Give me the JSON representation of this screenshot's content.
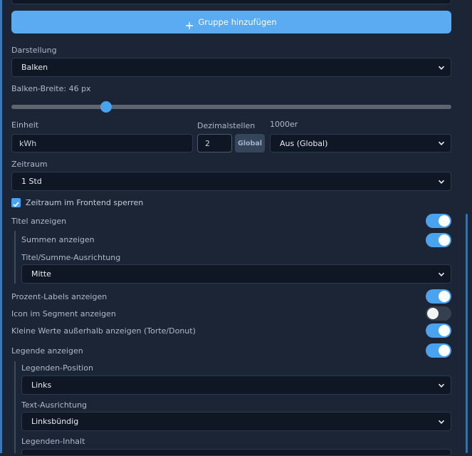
{
  "add_group_button": {
    "icon": "plus-icon",
    "label": "Gruppe hinzufügen"
  },
  "darstellung": {
    "label": "Darstellung",
    "value": "Balken"
  },
  "balken_breite": {
    "label": "Balken-Breite: 46 px",
    "slider_fraction": 0.216
  },
  "einheit": {
    "label": "Einheit",
    "value": "kWh"
  },
  "dezimalstellen": {
    "label": "Dezimalstellen",
    "value": "2",
    "global_button": "Global"
  },
  "tausender": {
    "label": "1000er",
    "value": "Aus (Global)"
  },
  "zeitraum": {
    "label": "Zeitraum",
    "value": "1 Std"
  },
  "zeitraum_sperren": {
    "label": "Zeitraum im Frontend sperren",
    "checked": true
  },
  "titel_anzeigen": {
    "label": "Titel anzeigen",
    "on": true
  },
  "summen_anzeigen": {
    "label": "Summen anzeigen",
    "on": true
  },
  "ausrichtung": {
    "label": "Titel/Summe-Ausrichtung",
    "value": "Mitte"
  },
  "prozent_labels": {
    "label": "Prozent-Labels anzeigen",
    "on": true
  },
  "icon_segment": {
    "label": "Icon im Segment anzeigen",
    "on": false
  },
  "kleine_werte": {
    "label": "Kleine Werte außerhalb anzeigen (Torte/Donut)",
    "on": true
  },
  "legende_anzeigen": {
    "label": "Legende anzeigen",
    "on": true
  },
  "legenden_position": {
    "label": "Legenden-Position",
    "value": "Links"
  },
  "text_ausrichtung": {
    "label": "Text-Ausrichtung",
    "value": "Linksbündig"
  },
  "legenden_inhalt": {
    "label": "Legenden-Inhalt"
  },
  "colors": {
    "accent": "#4aa3ee",
    "button": "#5aabf2",
    "background": "#1b2535",
    "field": "#0f1724"
  }
}
